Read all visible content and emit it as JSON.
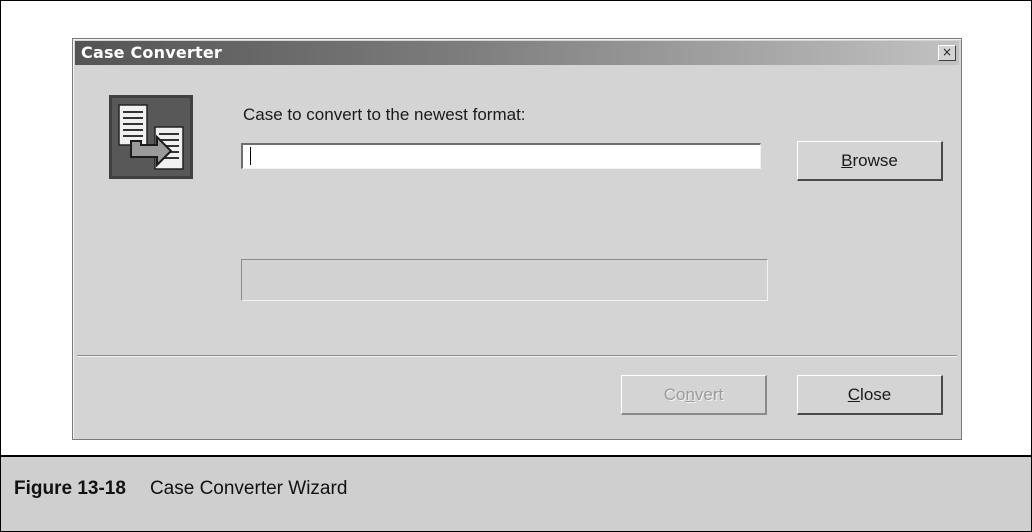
{
  "dialog": {
    "title": "Case Converter",
    "close_glyph": "×",
    "icon": "case-convert-icon",
    "prompt": "Case to convert to the newest format:",
    "path_value": "",
    "progress": 0,
    "browse_pre": "",
    "browse_key": "B",
    "browse_post": "rowse",
    "convert_pre": "Co",
    "convert_key": "n",
    "convert_post": "vert",
    "close_pre": "",
    "close_key": "C",
    "close_post": "lose",
    "convert_enabled": false
  },
  "figure": {
    "label": "Figure 13-18",
    "title": "Case Converter Wizard"
  }
}
